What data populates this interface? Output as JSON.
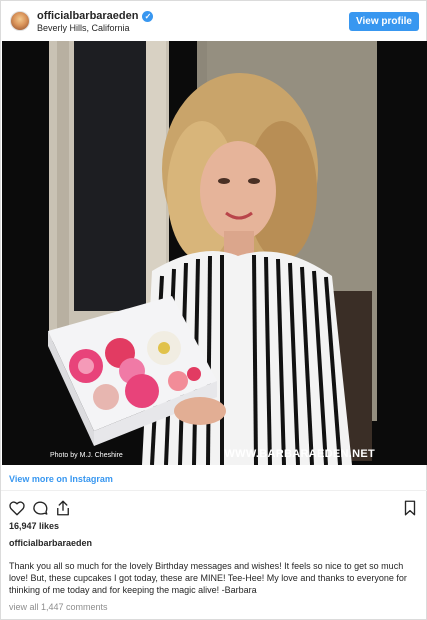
{
  "header": {
    "username": "officialbarbaraeden",
    "location": "Beverly Hills, California",
    "view_profile": "View profile",
    "verified_icon": "verified-check-icon"
  },
  "photo": {
    "credit_left": "Photo by M.J. Cheshire",
    "credit_right": "WWW.BARBARAEDEN.NET"
  },
  "view_more": "View more on Instagram",
  "actions": {
    "icons": [
      "heart-icon",
      "comment-icon",
      "share-icon",
      "bookmark-icon"
    ]
  },
  "likes": "16,947 likes",
  "caption_user": "officialbarbaraeden",
  "caption": "Thank you all so much for the lovely Birthday messages and wishes! It feels so nice to get so much love! But, these cupcakes I got today, these are MINE! Tee-Hee! My love and thanks to everyone for thinking of me today and for keeping the magic alive! -Barbara",
  "comments_link": "view all 1,447 comments",
  "colors": {
    "accent": "#3897f0",
    "text": "#262626",
    "muted": "#8e8e8e"
  }
}
